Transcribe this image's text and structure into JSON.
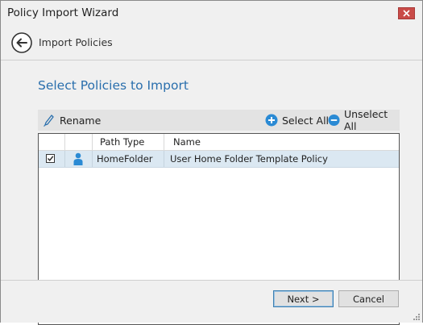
{
  "window": {
    "title": "Policy Import Wizard"
  },
  "header": {
    "title": "Import Policies"
  },
  "main": {
    "section_title": "Select Policies to Import",
    "toolbar": {
      "rename_label": "Rename",
      "select_all_label": "Select All",
      "unselect_all_label": "Unselect All"
    },
    "table": {
      "columns": [
        "",
        "",
        "Path Type",
        "Name"
      ],
      "rows": [
        {
          "checked": true,
          "icon": "user-icon",
          "path_type": "HomeFolder",
          "name": "User Home Folder Template Policy"
        }
      ]
    }
  },
  "footer": {
    "next_label": "Next >",
    "cancel_label": "Cancel"
  },
  "colors": {
    "accent": "#2a6fad",
    "close": "#c94b48",
    "selected_row": "#dbe8f2",
    "icon_blue": "#2a8ad4"
  }
}
